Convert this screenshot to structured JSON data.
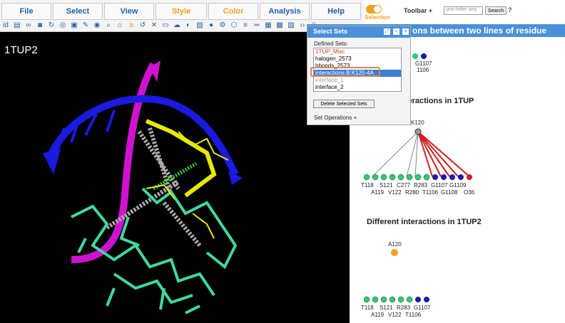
{
  "menu": [
    "File",
    "Select",
    "View",
    "Style",
    "Color",
    "Analysis",
    "Help"
  ],
  "toolbar_icons": [
    "id",
    "doc",
    "link",
    "camera",
    "refresh",
    "target",
    "save",
    "pen",
    "eye",
    "zoom",
    "home",
    "a",
    "undo",
    "x",
    "rect",
    "cloud",
    "half",
    "cube",
    "sphere",
    "gear",
    "hex",
    "lines",
    "eq",
    "grid",
    "map",
    "img",
    "code",
    "doc2"
  ],
  "viewer": {
    "label": "1TUP2"
  },
  "top_right": {
    "selection_label": "Selection",
    "toolbar_label": "Toolbar",
    "plus": "+",
    "search_placeholder": "one-letter seq",
    "search_button": "Search",
    "help": "?"
  },
  "title_bar": "ons between two lines of residue nodes",
  "dialog": {
    "title": "Select Sets",
    "defined_sets_label": "Defined Sets:",
    "items": [
      "1TUP_Misc",
      "halogen_2573",
      "hbonds_2573",
      "interactions.B:K120-4A",
      "interface_1",
      "interface_2"
    ],
    "delete_button": "Delete Selected Sets",
    "set_ops": "Set Operations",
    "set_ops_plus": "+"
  },
  "section1": {
    "top_labels": [
      "G1107",
      "1106"
    ],
    "title": "interactions in 1TUP",
    "center_node": "K120",
    "row1_labels": [
      "T118",
      "S121",
      "C277",
      "R283",
      "G1107",
      "G1109"
    ],
    "row2_labels": [
      "A119",
      "V122",
      "R280",
      "T1106",
      "G1108",
      "O36"
    ]
  },
  "section2": {
    "title": "Different interactions in 1TUP2",
    "center_node": "A120",
    "row1_labels": [
      "T118",
      "S121",
      "R283",
      "G1107"
    ],
    "row2_labels": [
      "A119",
      "V122",
      "T1106"
    ]
  },
  "colors": {
    "title_bar": "#4a90d9",
    "toggle": "#f0a020",
    "node_green": "#2ecc71",
    "node_blue": "#1a1aa8",
    "node_red": "#cc2222",
    "node_orange": "#f0a020"
  }
}
